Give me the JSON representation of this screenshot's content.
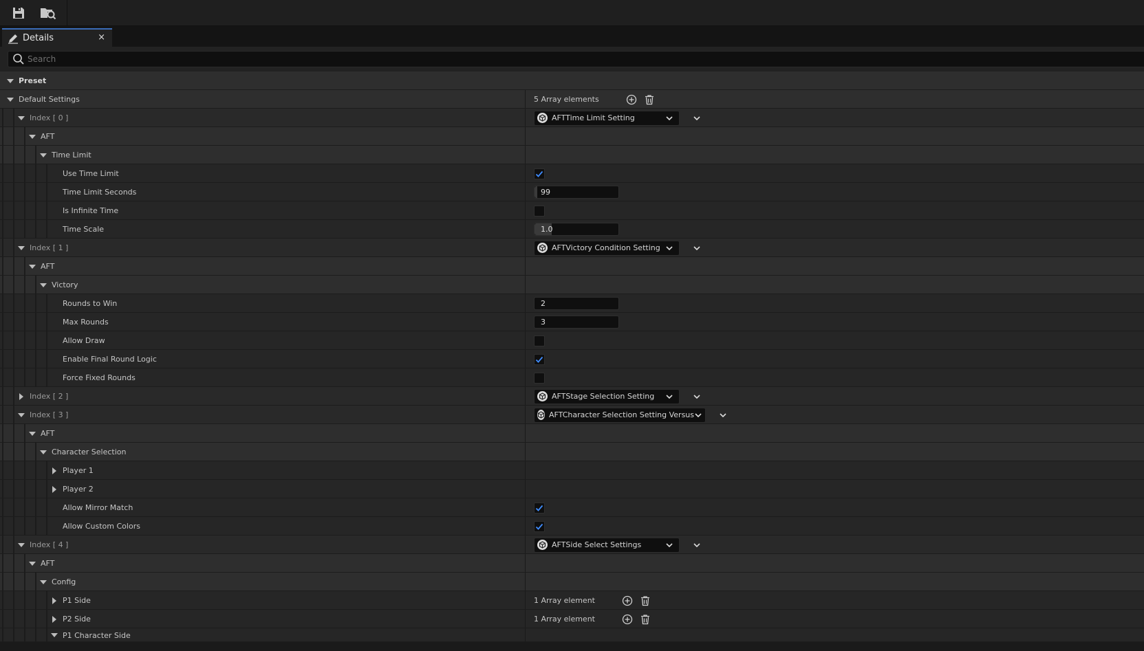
{
  "toolbar": {
    "save_icon": "save-icon",
    "browse_icon": "find-in-content-browser-icon"
  },
  "tab": {
    "label": "Details",
    "close": "×"
  },
  "search": {
    "placeholder": "Search"
  },
  "rows": [
    {
      "kind": "cat",
      "depth": 0,
      "label": "Preset",
      "bold": true,
      "expanded": true
    },
    {
      "kind": "cat",
      "depth": 0,
      "label": "Default Settings",
      "expanded": true,
      "value": {
        "type": "array",
        "count": "5 Array elements"
      }
    },
    {
      "kind": "sub",
      "depth": 1,
      "label": "Index [ 0 ]",
      "dim": true,
      "expanded": true,
      "value": {
        "type": "dropdown",
        "text": "AFTTime Limit Setting",
        "width": 212
      }
    },
    {
      "kind": "cat",
      "depth": 2,
      "label": "AFT",
      "expanded": true
    },
    {
      "kind": "cat",
      "depth": 3,
      "label": "Time Limit",
      "expanded": true
    },
    {
      "kind": "prop",
      "depth": 4,
      "label": "Use Time Limit",
      "value": {
        "type": "check",
        "checked": true
      }
    },
    {
      "kind": "prop",
      "depth": 4,
      "label": "Time Limit Seconds",
      "value": {
        "type": "number",
        "text": "99",
        "fill": 0.03
      }
    },
    {
      "kind": "prop",
      "depth": 4,
      "label": "Is Infinite Time",
      "value": {
        "type": "check",
        "checked": false
      }
    },
    {
      "kind": "prop",
      "depth": 4,
      "label": "Time Scale",
      "value": {
        "type": "number",
        "text": "1.0",
        "fill": 0.2
      }
    },
    {
      "kind": "sub",
      "depth": 1,
      "label": "Index [ 1 ]",
      "dim": true,
      "expanded": true,
      "value": {
        "type": "dropdown",
        "text": "AFTVictory Condition Setting",
        "width": 212
      }
    },
    {
      "kind": "cat",
      "depth": 2,
      "label": "AFT",
      "expanded": true
    },
    {
      "kind": "cat",
      "depth": 3,
      "label": "Victory",
      "expanded": true
    },
    {
      "kind": "prop",
      "depth": 4,
      "label": "Rounds to Win",
      "value": {
        "type": "number",
        "text": "2",
        "fill": 0
      }
    },
    {
      "kind": "prop",
      "depth": 4,
      "label": "Max Rounds",
      "value": {
        "type": "number",
        "text": "3",
        "fill": 0
      }
    },
    {
      "kind": "prop",
      "depth": 4,
      "label": "Allow Draw",
      "value": {
        "type": "check",
        "checked": false
      }
    },
    {
      "kind": "prop",
      "depth": 4,
      "label": "Enable Final Round Logic",
      "value": {
        "type": "check",
        "checked": true
      }
    },
    {
      "kind": "prop",
      "depth": 4,
      "label": "Force Fixed Rounds",
      "value": {
        "type": "check",
        "checked": false
      }
    },
    {
      "kind": "sub",
      "depth": 1,
      "label": "Index [ 2 ]",
      "dim": true,
      "expanded": false,
      "value": {
        "type": "dropdown",
        "text": "AFTStage Selection Setting",
        "width": 212
      }
    },
    {
      "kind": "sub",
      "depth": 1,
      "label": "Index [ 3 ]",
      "dim": true,
      "expanded": true,
      "value": {
        "type": "dropdown",
        "text": "AFTCharacter Selection Setting Versus",
        "width": 250
      }
    },
    {
      "kind": "cat",
      "depth": 2,
      "label": "AFT",
      "expanded": true
    },
    {
      "kind": "cat",
      "depth": 3,
      "label": "Character Selection",
      "expanded": true
    },
    {
      "kind": "prop",
      "depth": 4,
      "label": "Player 1",
      "expanded": false,
      "arrow": true
    },
    {
      "kind": "prop",
      "depth": 4,
      "label": "Player 2",
      "expanded": false,
      "arrow": true
    },
    {
      "kind": "prop",
      "depth": 4,
      "label": "Allow Mirror Match",
      "value": {
        "type": "check",
        "checked": true
      }
    },
    {
      "kind": "prop",
      "depth": 4,
      "label": "Allow Custom Colors",
      "value": {
        "type": "check",
        "checked": true
      }
    },
    {
      "kind": "sub",
      "depth": 1,
      "label": "Index [ 4 ]",
      "dim": true,
      "expanded": true,
      "value": {
        "type": "dropdown",
        "text": "AFTSide Select Settings",
        "width": 212
      }
    },
    {
      "kind": "cat",
      "depth": 2,
      "label": "AFT",
      "expanded": true
    },
    {
      "kind": "cat",
      "depth": 3,
      "label": "Config",
      "expanded": true
    },
    {
      "kind": "prop",
      "depth": 4,
      "label": "P1 Side",
      "expanded": false,
      "arrow": true,
      "value": {
        "type": "array",
        "count": "1 Array element"
      }
    },
    {
      "kind": "prop",
      "depth": 4,
      "label": "P2 Side",
      "expanded": false,
      "arrow": true,
      "value": {
        "type": "array",
        "count": "1 Array element"
      }
    },
    {
      "kind": "prop",
      "depth": 4,
      "label": "P1 Character Side",
      "expanded": true,
      "arrow": true
    }
  ]
}
